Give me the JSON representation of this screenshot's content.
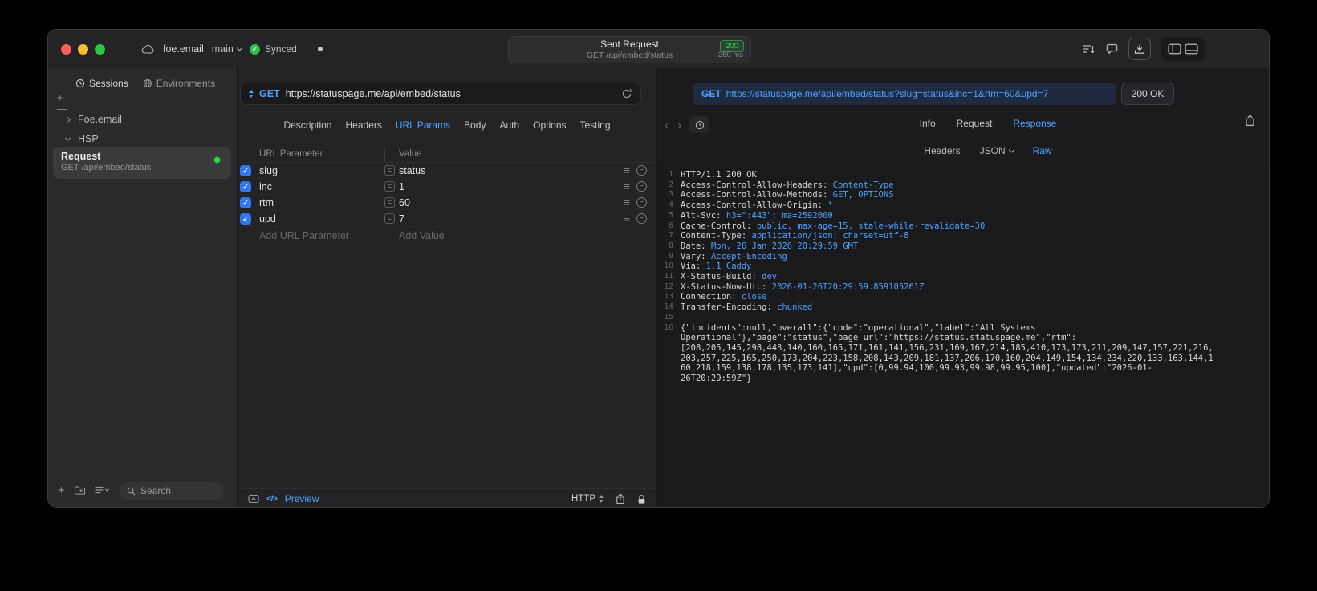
{
  "colors": {
    "plain": "#d8d8da",
    "val": "#4da3ff",
    "accent": "#4da3ff",
    "green": "#30d158",
    "checkbox_blue": "#2f78f2"
  },
  "titlebar": {
    "project": "foe.email",
    "branch": "main",
    "sync_label": "Synced",
    "summary": {
      "title": "Sent Request",
      "status_code": "200",
      "subtitle": "GET /api/embed/status",
      "duration": "280 ms"
    }
  },
  "sidebar": {
    "tab_sessions": "Sessions",
    "tab_environments": "Environments",
    "group_foe": "Foe.email",
    "group_hsp": "HSP",
    "request_item": {
      "title": "Request",
      "subtitle": "GET /api/embed/status"
    },
    "search_placeholder": "Search"
  },
  "request_editor": {
    "method": "GET",
    "url": "https://statuspage.me/api/embed/status",
    "tabs": [
      "Description",
      "Headers",
      "URL Params",
      "Body",
      "Auth",
      "Options",
      "Testing"
    ],
    "active_tab": "URL Params",
    "params": {
      "col_name": "URL Parameter",
      "col_value": "Value",
      "rows": [
        {
          "name": "slug",
          "value": "status",
          "enabled": true
        },
        {
          "name": "inc",
          "value": "1",
          "enabled": true
        },
        {
          "name": "rtm",
          "value": "60",
          "enabled": true
        },
        {
          "name": "upd",
          "value": "7",
          "enabled": true
        }
      ],
      "add_name": "Add URL Parameter",
      "add_value": "Add Value"
    },
    "footer": {
      "code": "</>",
      "preview": "Preview",
      "protocol": "HTTP"
    }
  },
  "response_viewer": {
    "method": "GET",
    "url": "https://statuspage.me/api/embed/status?slug=status&inc=1&rtm=60&upd=7",
    "status": "200 OK",
    "tabs": [
      "Info",
      "Request",
      "Response"
    ],
    "active_tab": "Response",
    "subtabs": [
      "Headers",
      "JSON",
      "Raw"
    ],
    "active_subtab": "Raw",
    "lines": [
      {
        "n": "1",
        "parts": [
          {
            "t": "HTTP/1.1 200 OK",
            "c": "plain"
          }
        ]
      },
      {
        "n": "2",
        "parts": [
          {
            "t": "Access-Control-Allow-Headers: ",
            "c": "plain"
          },
          {
            "t": "Content-Type",
            "c": "val"
          }
        ]
      },
      {
        "n": "3",
        "parts": [
          {
            "t": "Access-Control-Allow-Methods: ",
            "c": "plain"
          },
          {
            "t": "GET, OPTIONS",
            "c": "val"
          }
        ]
      },
      {
        "n": "4",
        "parts": [
          {
            "t": "Access-Control-Allow-Origin: ",
            "c": "plain"
          },
          {
            "t": "*",
            "c": "val"
          }
        ]
      },
      {
        "n": "5",
        "parts": [
          {
            "t": "Alt-Svc: ",
            "c": "plain"
          },
          {
            "t": "h3=\":443\"; ma=2592000",
            "c": "val"
          }
        ]
      },
      {
        "n": "6",
        "parts": [
          {
            "t": "Cache-Control: ",
            "c": "plain"
          },
          {
            "t": "public, max-age=15, stale-while-revalidate=30",
            "c": "val"
          }
        ]
      },
      {
        "n": "7",
        "parts": [
          {
            "t": "Content-Type: ",
            "c": "plain"
          },
          {
            "t": "application/json; charset=utf-8",
            "c": "val"
          }
        ]
      },
      {
        "n": "8",
        "parts": [
          {
            "t": "Date: ",
            "c": "plain"
          },
          {
            "t": "Mon, 26 Jan 2026 20:29:59 GMT",
            "c": "val"
          }
        ]
      },
      {
        "n": "9",
        "parts": [
          {
            "t": "Vary: ",
            "c": "plain"
          },
          {
            "t": "Accept-Encoding",
            "c": "val"
          }
        ]
      },
      {
        "n": "10",
        "parts": [
          {
            "t": "Via: ",
            "c": "plain"
          },
          {
            "t": "1.1 Caddy",
            "c": "val"
          }
        ]
      },
      {
        "n": "11",
        "parts": [
          {
            "t": "X-Status-Build: ",
            "c": "plain"
          },
          {
            "t": "dev",
            "c": "val"
          }
        ]
      },
      {
        "n": "12",
        "parts": [
          {
            "t": "X-Status-Now-Utc: ",
            "c": "plain"
          },
          {
            "t": "2026-01-26T20:29:59.859105261Z",
            "c": "val"
          }
        ]
      },
      {
        "n": "13",
        "parts": [
          {
            "t": "Connection: ",
            "c": "plain"
          },
          {
            "t": "close",
            "c": "val"
          }
        ]
      },
      {
        "n": "14",
        "parts": [
          {
            "t": "Transfer-Encoding: ",
            "c": "plain"
          },
          {
            "t": "chunked",
            "c": "val"
          }
        ]
      },
      {
        "n": "15",
        "parts": []
      },
      {
        "n": "16",
        "parts": [
          {
            "t": "{\"incidents\":null,\"overall\":{\"code\":\"operational\",\"label\":\"All Systems Operational\"},\"page\":\"status\",\"page_url\":\"https://status.statuspage.me\",\"rtm\":[208,205,145,298,443,140,160,165,171,161,141,156,231,169,167,214,185,410,173,173,211,209,147,157,221,216,203,257,225,165,250,173,204,223,158,208,143,209,181,137,206,170,160,204,149,154,134,234,220,133,163,144,160,218,159,138,178,135,173,141],\"upd\":[0,99.94,100,99.93,99.98,99.95,100],\"updated\":\"2026-01-26T20:29:59Z\"}",
            "c": "plain"
          }
        ]
      }
    ]
  }
}
